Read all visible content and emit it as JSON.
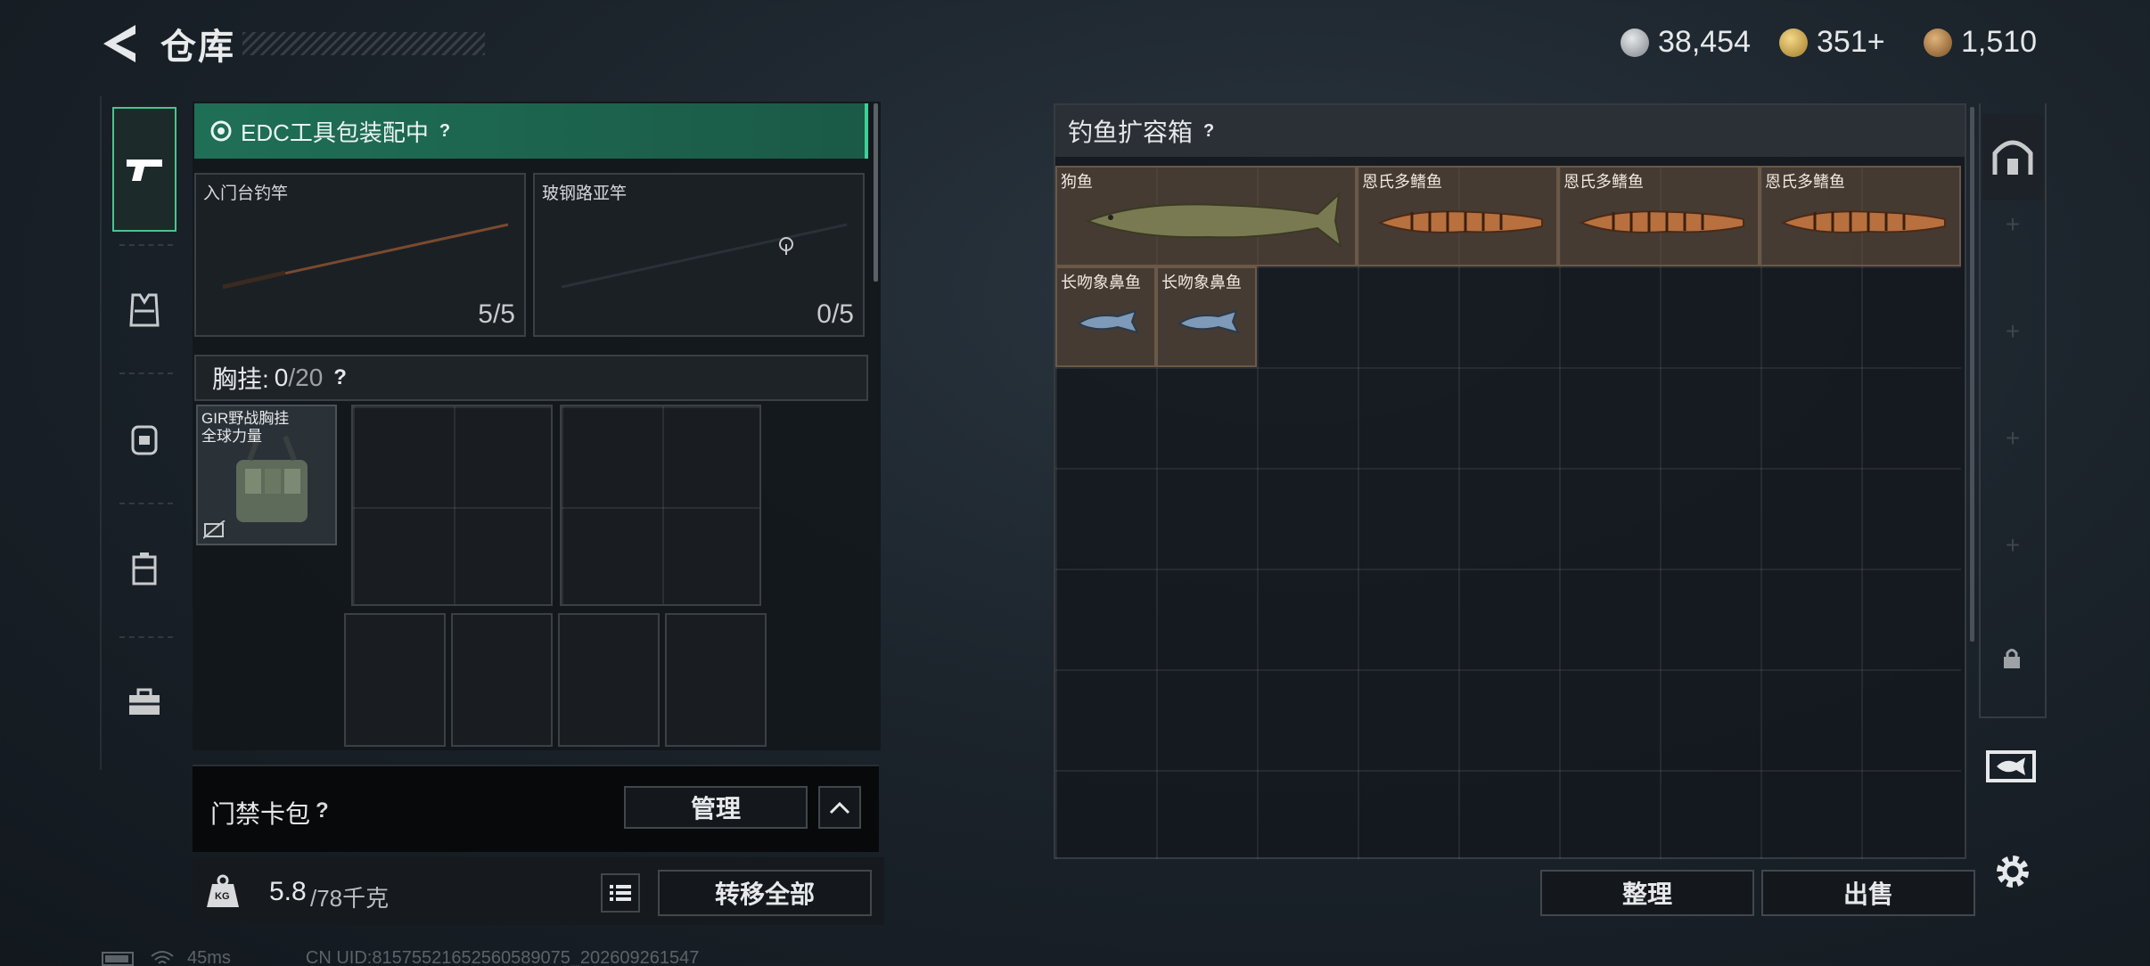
{
  "header": {
    "title": "仓库"
  },
  "currencies": [
    {
      "icon": "silver-coin-icon",
      "value": "38,454",
      "color": "#9aa0a6"
    },
    {
      "icon": "gold-triangle-icon",
      "value": "351+",
      "color": "#c9a44a"
    },
    {
      "icon": "bronze-token-icon",
      "value": "1,510",
      "color": "#b8864a"
    }
  ],
  "loadout": {
    "edc_status": "EDC工具包装配中",
    "help": "?",
    "rods": [
      {
        "label": "入门台钓竿",
        "count": "5/5"
      },
      {
        "label": "玻钢路亚竿",
        "count": "0/5"
      }
    ],
    "chest_rig_label": "胸挂:",
    "chest_rig_value": "0",
    "chest_rig_max": "/20",
    "chest_item_name": "GIR野战胸挂\n全球力量"
  },
  "access_card": {
    "label": "门禁卡包",
    "help": "?",
    "manage": "管理"
  },
  "weight": {
    "value": "5.8",
    "max": "/78千克",
    "icon_label": "KG"
  },
  "transfer_all": "转移全部",
  "storage": {
    "title": "钓鱼扩容箱",
    "help": "?",
    "items": [
      {
        "name": "狗鱼"
      },
      {
        "name": "恩氏多鳍鱼"
      },
      {
        "name": "恩氏多鳍鱼"
      },
      {
        "name": "恩氏多鳍鱼"
      },
      {
        "name": "长吻象鼻鱼"
      },
      {
        "name": "长吻象鼻鱼"
      }
    ]
  },
  "actions": {
    "sort": "整理",
    "sell": "出售"
  },
  "status_bar": {
    "ping": "45ms",
    "uid": "CN UID:815755216525605890​75_202609261547"
  }
}
